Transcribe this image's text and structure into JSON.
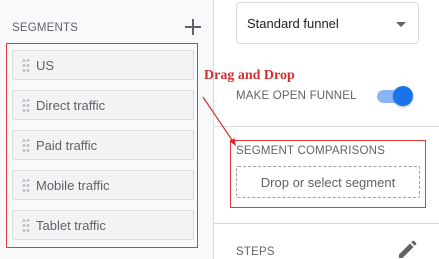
{
  "segments": {
    "title": "SEGMENTS",
    "add_icon": "plus-icon",
    "items": [
      {
        "label": "US"
      },
      {
        "label": "Direct traffic"
      },
      {
        "label": "Paid traffic"
      },
      {
        "label": "Mobile traffic"
      },
      {
        "label": "Tablet traffic"
      }
    ]
  },
  "annotation": {
    "text": "Drag and Drop",
    "color": "#d32f2f"
  },
  "funnel": {
    "selected": "Standard funnel",
    "open_funnel_label": "MAKE OPEN FUNNEL",
    "open_funnel_enabled": true
  },
  "comparisons": {
    "title": "SEGMENT COMPARISONS",
    "drop_placeholder": "Drop or select segment"
  },
  "steps": {
    "title": "STEPS",
    "edit_icon": "pencil-icon"
  },
  "colors": {
    "accent": "#1a73e8",
    "highlight_border": "#e53935"
  }
}
